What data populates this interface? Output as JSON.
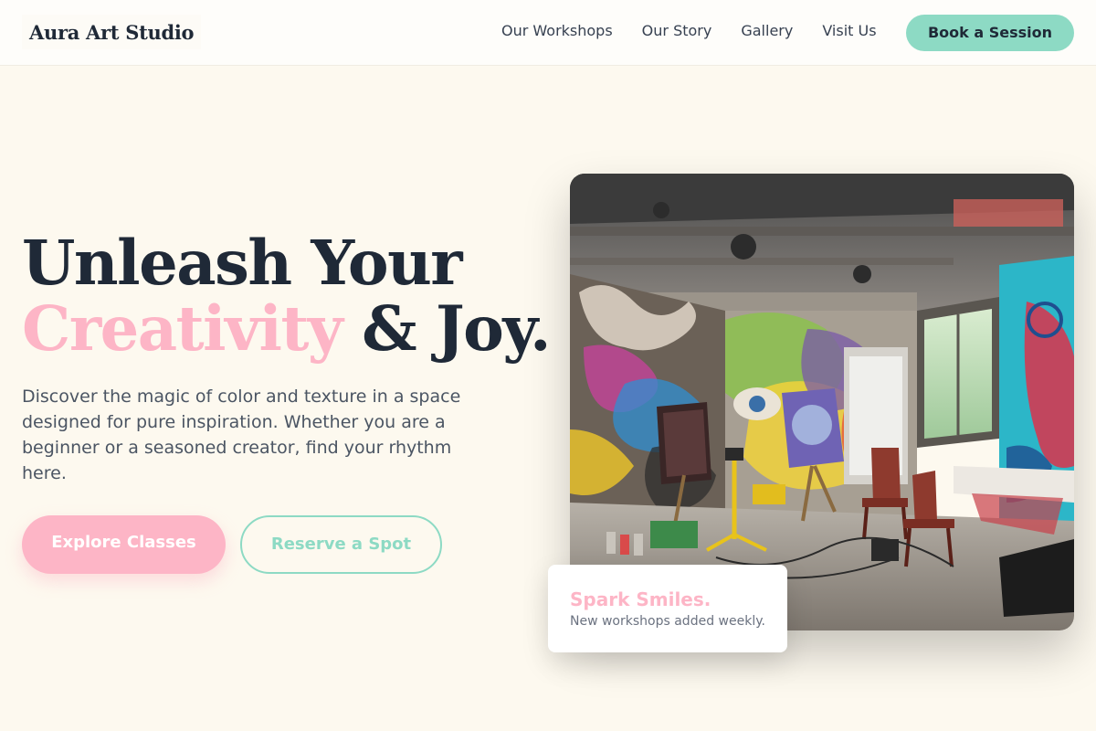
{
  "header": {
    "logo": "Aura Art Studio",
    "nav": [
      {
        "label": "Our Workshops"
      },
      {
        "label": "Our Story"
      },
      {
        "label": "Gallery"
      },
      {
        "label": "Visit Us"
      }
    ],
    "cta": "Book a Session"
  },
  "hero": {
    "title_line1": "Unleash Your",
    "title_accent": "Creativity",
    "title_rest": " & Joy.",
    "description": "Discover the magic of color and texture in a space designed for pure inspiration. Whether you are a beginner or a seasoned creator, find your rhythm here.",
    "primary_button": "Explore Classes",
    "secondary_button": "Reserve a Spot"
  },
  "card": {
    "title": "Spark Smiles.",
    "subtitle": "New workshops added weekly."
  },
  "colors": {
    "background": "#fdf9ef",
    "pink": "#fdb5c6",
    "mint": "#8ddac4",
    "ink": "#1f2937"
  }
}
